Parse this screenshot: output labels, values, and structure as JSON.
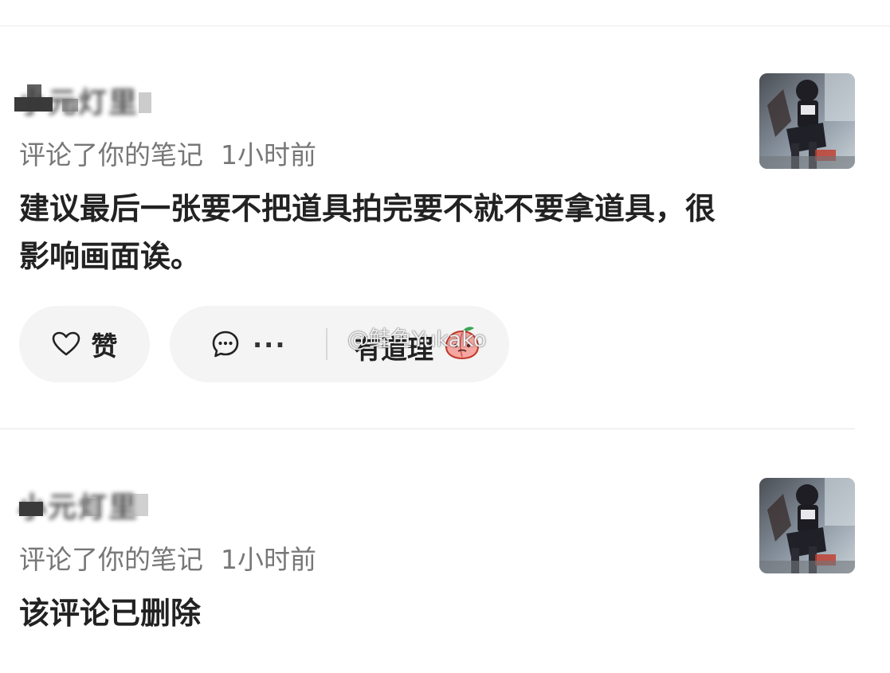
{
  "notifications": [
    {
      "username": "小元灯里",
      "action": "评论了你的笔记",
      "time": "1小时前",
      "content": "建议最后一张要不把道具拍完要不就不要拿道具，很影响画面诶。",
      "actions": {
        "like_label": "赞",
        "reply_ellipsis": "...",
        "quick_reply": "有道理"
      },
      "thumbnail_icon": "cosplay-photo"
    },
    {
      "username": "小元灯里",
      "action": "评论了你的笔记",
      "time": "1小时前",
      "content": "该评论已删除",
      "thumbnail_icon": "cosplay-photo"
    }
  ],
  "watermark": "@鲑鱼Yukako",
  "icons": {
    "like": "heart-outline-icon",
    "reply": "chat-bubble-icon",
    "emoji": "peach-emoji"
  },
  "colors": {
    "background": "#ffffff",
    "button_bg": "#f4f4f4",
    "meta_text": "#777777",
    "divider": "#e6e6e6"
  }
}
